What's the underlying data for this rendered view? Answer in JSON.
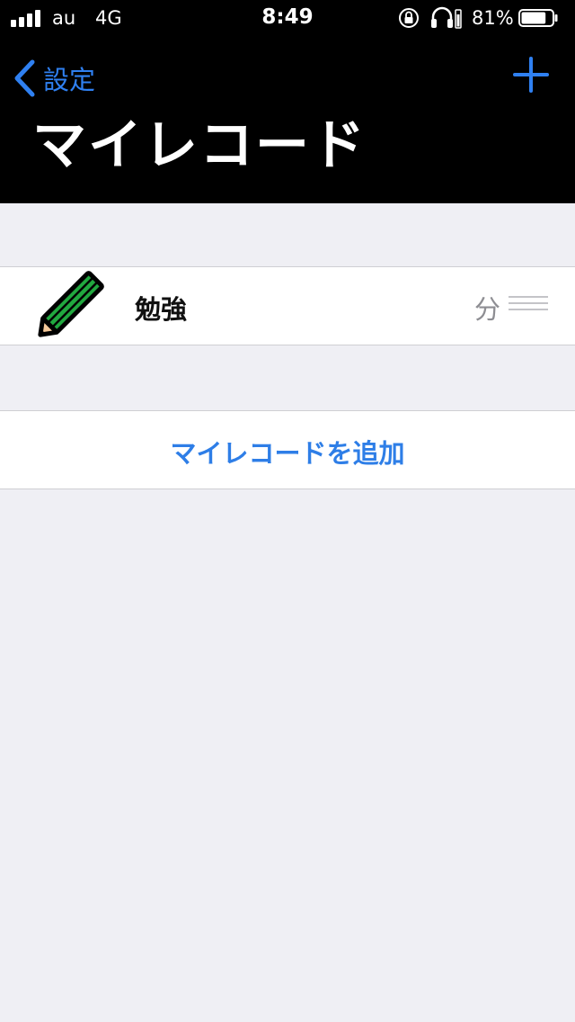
{
  "status": {
    "carrier": "au",
    "network": "4G",
    "time": "8:49",
    "battery_percent": "81%",
    "battery_level": 0.81
  },
  "nav": {
    "back_label": "設定",
    "title": "マイレコード",
    "add_icon": "plus-icon",
    "back_icon": "chevron-left-icon"
  },
  "records": [
    {
      "icon": "pencil-icon",
      "label": "勉強",
      "unit": "分"
    }
  ],
  "add_record_label": "マイレコードを追加",
  "colors": {
    "accent": "#2f80f1",
    "background": "#efeff4",
    "pencil_green": "#21a83f"
  }
}
